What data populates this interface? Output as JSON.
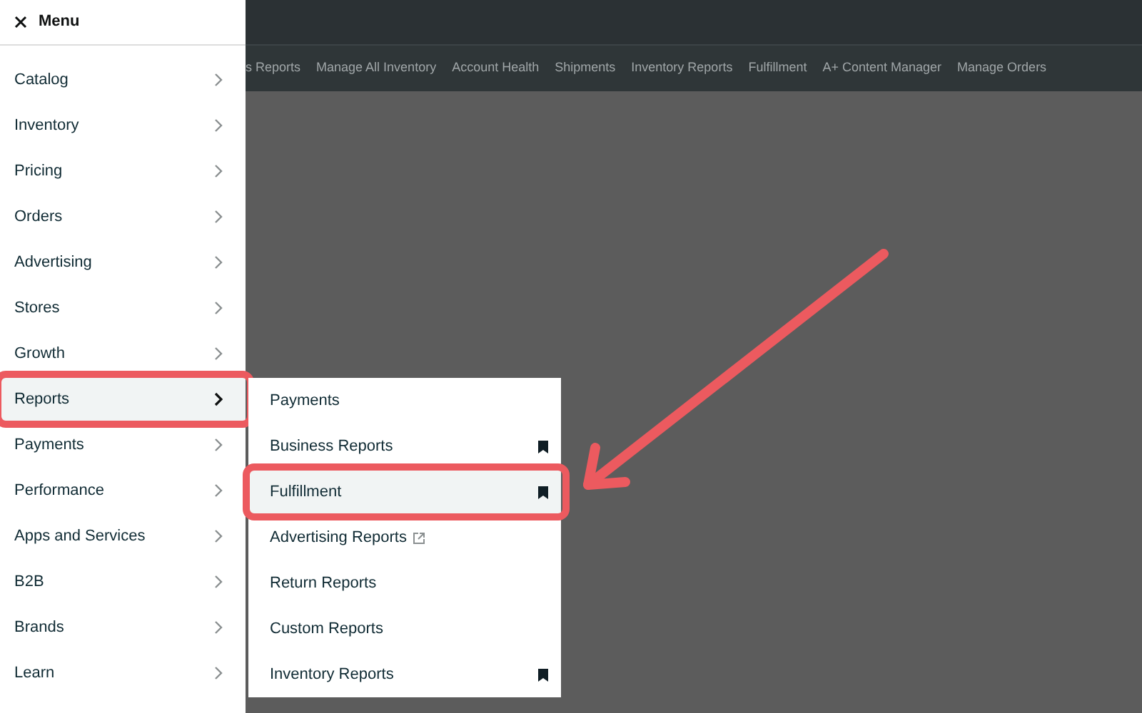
{
  "menu": {
    "title": "Menu",
    "items": [
      {
        "label": "Catalog",
        "selected": false,
        "highlighted": false
      },
      {
        "label": "Inventory",
        "selected": false,
        "highlighted": false
      },
      {
        "label": "Pricing",
        "selected": false,
        "highlighted": false
      },
      {
        "label": "Orders",
        "selected": false,
        "highlighted": false
      },
      {
        "label": "Advertising",
        "selected": false,
        "highlighted": false
      },
      {
        "label": "Stores",
        "selected": false,
        "highlighted": false
      },
      {
        "label": "Growth",
        "selected": false,
        "highlighted": false
      },
      {
        "label": "Reports",
        "selected": true,
        "highlighted": true
      },
      {
        "label": "Payments",
        "selected": false,
        "highlighted": false
      },
      {
        "label": "Performance",
        "selected": false,
        "highlighted": false
      },
      {
        "label": "Apps and Services",
        "selected": false,
        "highlighted": false
      },
      {
        "label": "B2B",
        "selected": false,
        "highlighted": false
      },
      {
        "label": "Brands",
        "selected": false,
        "highlighted": false
      },
      {
        "label": "Learn",
        "selected": false,
        "highlighted": false
      }
    ]
  },
  "nav_links": [
    "s Reports",
    "Manage All Inventory",
    "Account Health",
    "Shipments",
    "Inventory Reports",
    "Fulfillment",
    "A+ Content Manager",
    "Manage Orders"
  ],
  "submenu": {
    "items": [
      {
        "label": "Payments",
        "selected": false,
        "highlighted": false,
        "bookmarked": false,
        "external": false
      },
      {
        "label": "Business Reports",
        "selected": false,
        "highlighted": false,
        "bookmarked": true,
        "external": false
      },
      {
        "label": "Fulfillment",
        "selected": true,
        "highlighted": true,
        "bookmarked": true,
        "external": false
      },
      {
        "label": "Advertising Reports",
        "selected": false,
        "highlighted": false,
        "bookmarked": false,
        "external": true
      },
      {
        "label": "Return Reports",
        "selected": false,
        "highlighted": false,
        "bookmarked": false,
        "external": false
      },
      {
        "label": "Custom Reports",
        "selected": false,
        "highlighted": false,
        "bookmarked": false,
        "external": false
      },
      {
        "label": "Inventory Reports",
        "selected": false,
        "highlighted": false,
        "bookmarked": true,
        "external": false
      }
    ]
  }
}
